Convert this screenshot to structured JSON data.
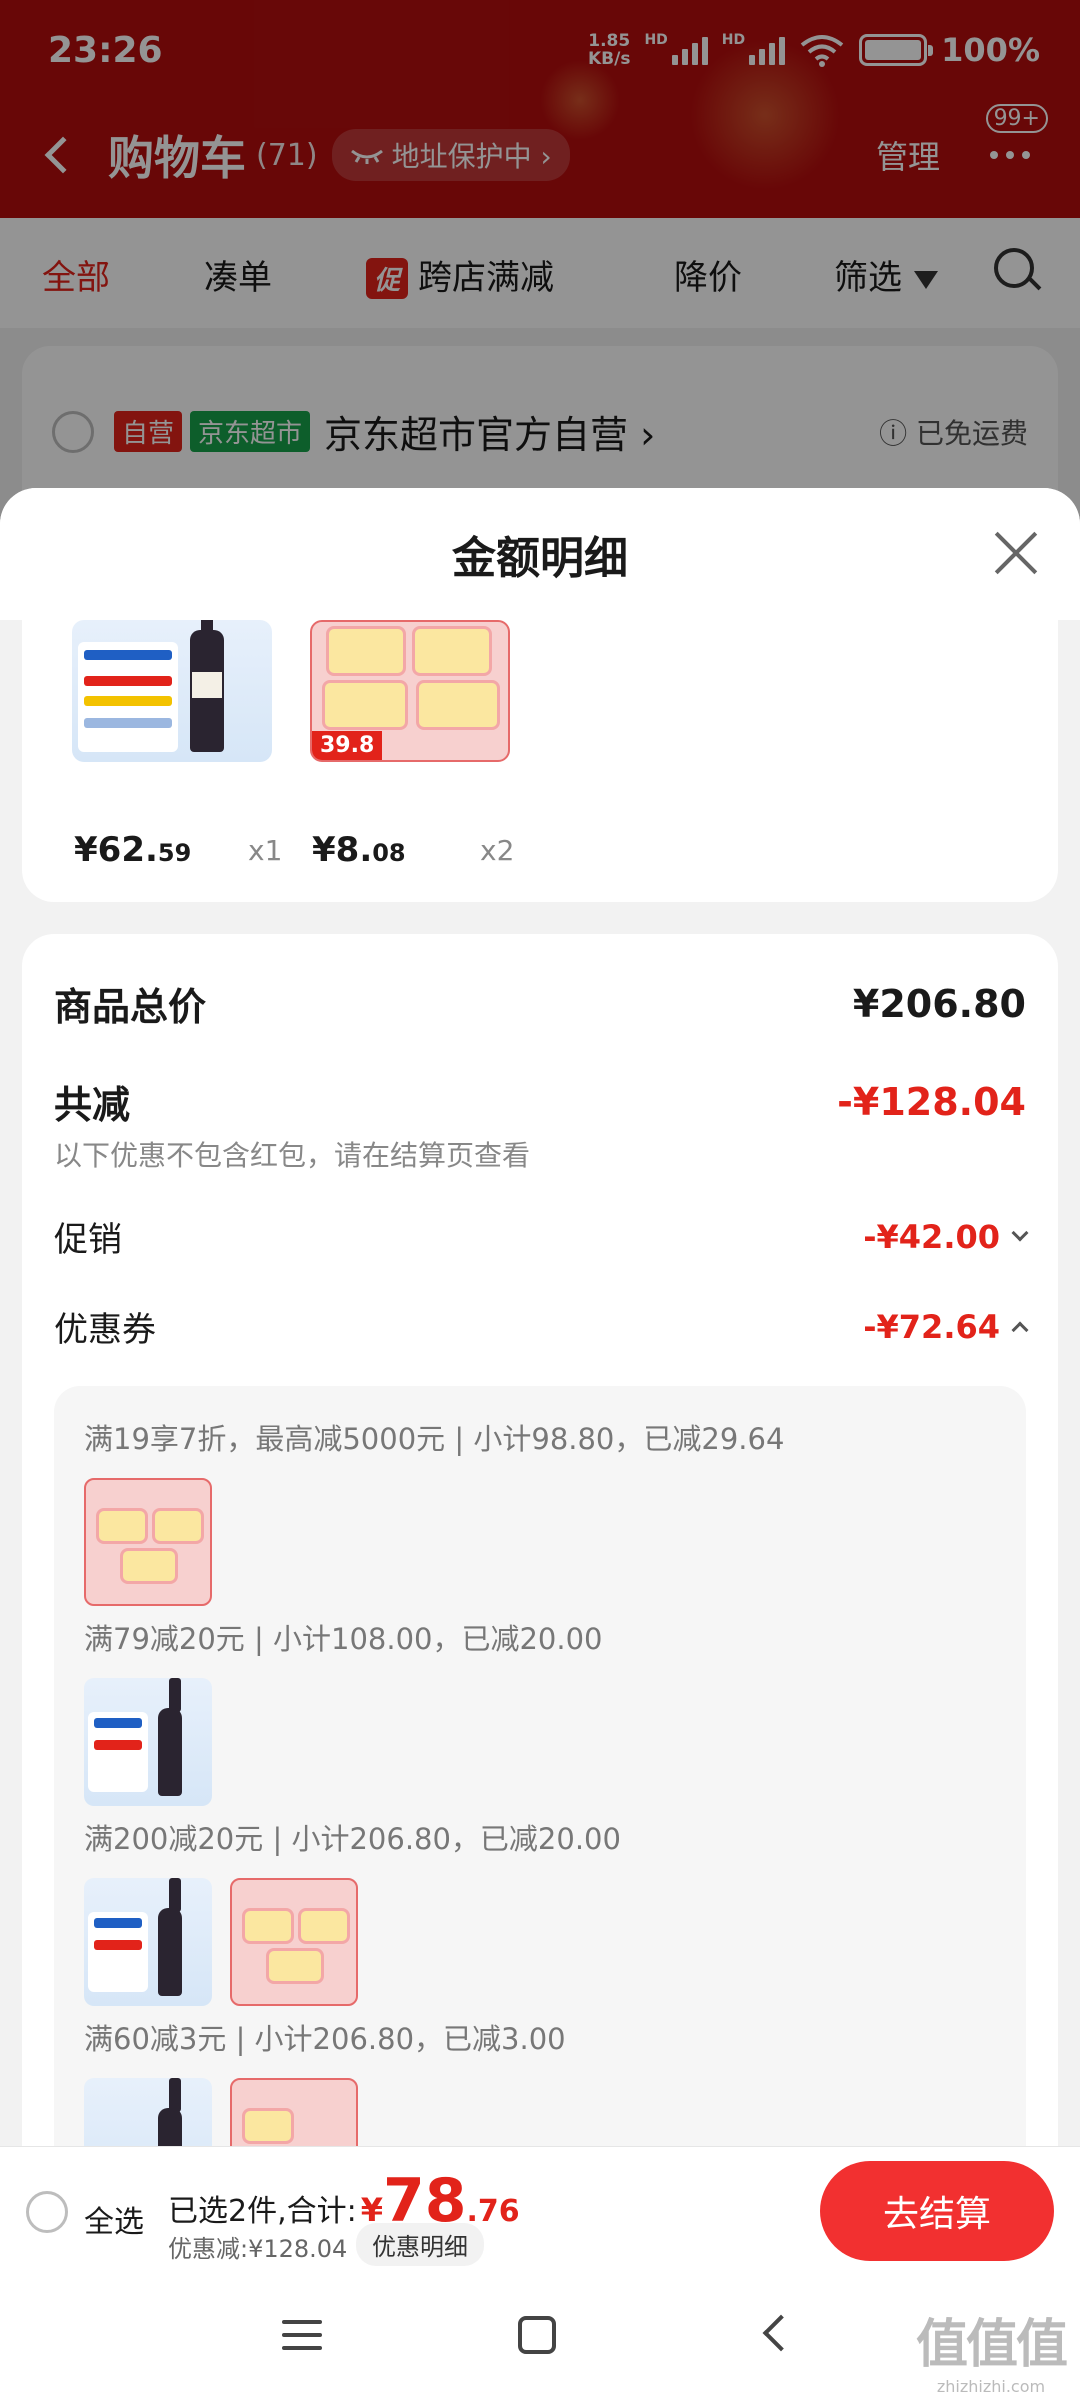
{
  "status_bar": {
    "time": "23:26",
    "net_speed_value": "1.85",
    "net_speed_unit": "KB/s",
    "signal_label": "HD",
    "battery": "100%"
  },
  "header": {
    "title": "购物车",
    "count": "(71)",
    "address_pill": "地址保护中 ›",
    "manage": "管理",
    "more_badge": "99+"
  },
  "tabs": {
    "all": "全部",
    "combine": "凑单",
    "promo_tag": "促",
    "cross_store": "跨店满减",
    "price_drop": "降价",
    "filter": "筛选"
  },
  "store": {
    "tag_self": "自营",
    "tag_market": "京东超市",
    "name": "京东超市官方自营 ›",
    "shipping": "ⓘ 已免运费"
  },
  "sheet": {
    "title": "金额明细",
    "products": [
      {
        "price_int": "¥62.",
        "price_dec": "59",
        "qty": "x1"
      },
      {
        "price_int": "¥8.",
        "price_dec": "08",
        "qty": "x2"
      }
    ],
    "tissue_price_tag": "39.8",
    "total_label": "商品总价",
    "total_value": "¥206.80",
    "reduce_label": "共减",
    "reduce_value": "-¥128.04",
    "reduce_note": "以下优惠不包含红包，请在结算页查看",
    "promo_label": "促销",
    "promo_value": "-¥42.00",
    "coupon_label": "优惠券",
    "coupon_value": "-¥72.64",
    "coupon_lines": [
      "满19享7折，最高减5000元 | 小计98.80，已减29.64",
      "满79减20元 | 小计108.00，已减20.00",
      "满200减20元 | 小计206.80，已减20.00",
      "满60减3元 | 小计206.80，已减3.00"
    ]
  },
  "bottom_bar": {
    "select_all": "全选",
    "selected_text": "已选2件,合计:",
    "currency": "¥",
    "total_int": "78",
    "total_dec": ".76",
    "discount_text": "优惠减:¥128.04",
    "detail_link": "优惠明细",
    "checkout": "去结算"
  },
  "watermark": {
    "big": "值值值",
    "small": "zhizhizhi.com"
  },
  "colors": {
    "header_red": "#b40d0d",
    "accent_red": "#e2231a",
    "checkout_red": "#f23030"
  }
}
